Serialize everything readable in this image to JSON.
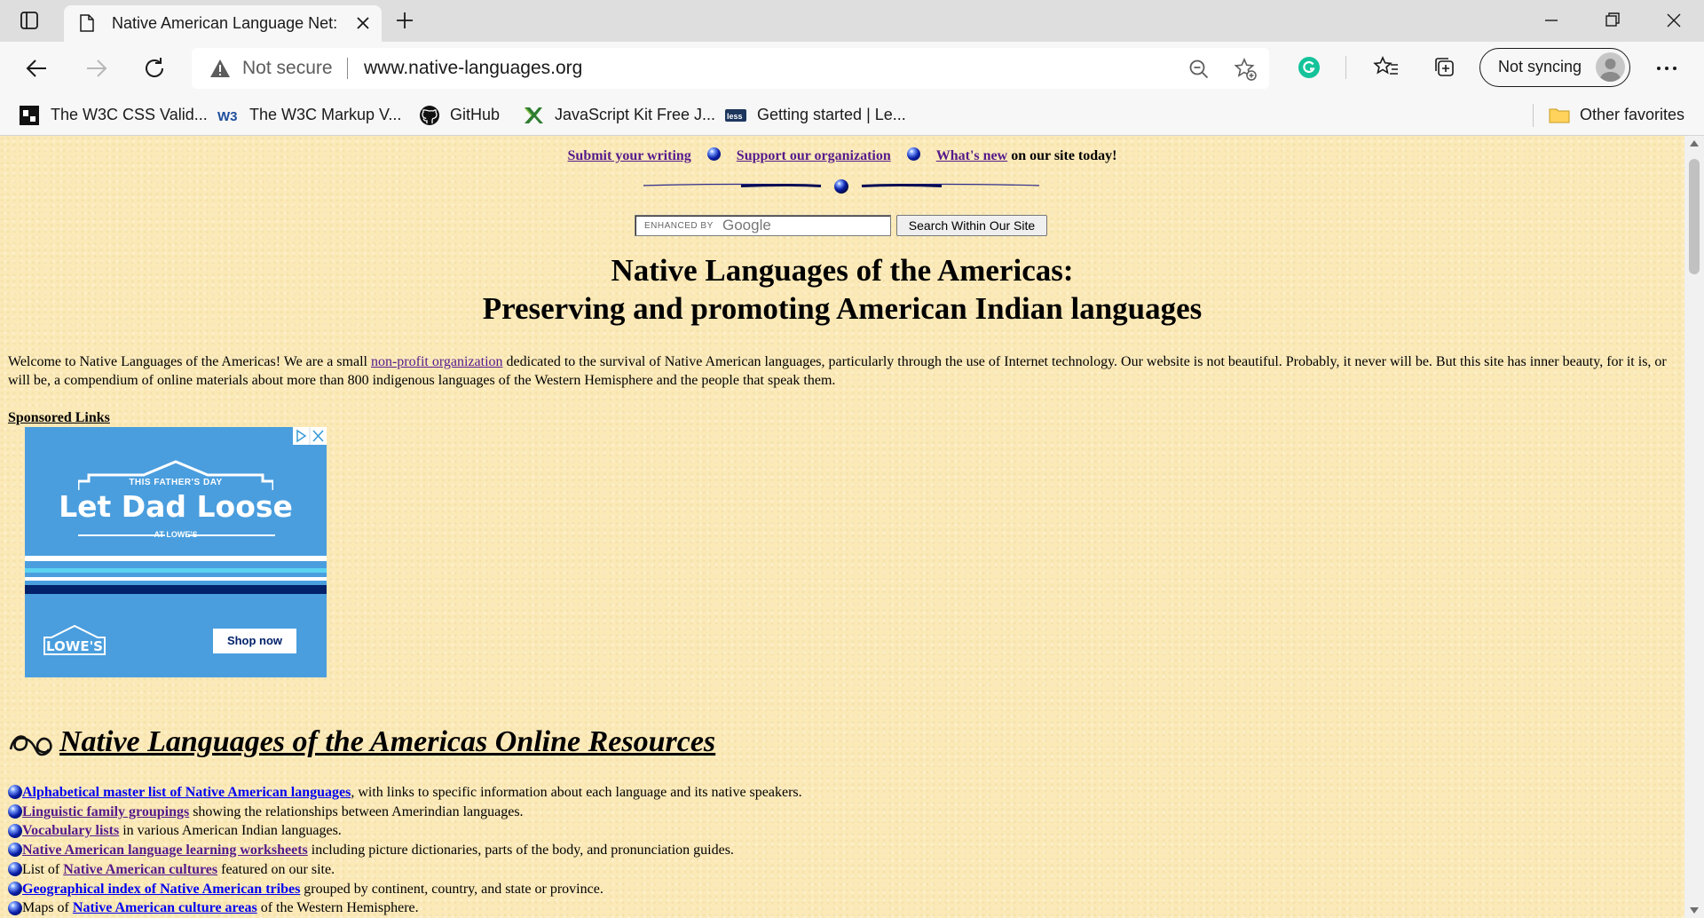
{
  "browser": {
    "tab_title": "Native American Language Net: L",
    "address": {
      "security_label": "Not secure",
      "url": "www.native-languages.org"
    },
    "profile_label": "Not syncing",
    "bookmarks": [
      {
        "label": "The W3C CSS Valid...",
        "icon": "w3c-css-icon"
      },
      {
        "label": "The W3C Markup V...",
        "icon": "w3c-icon"
      },
      {
        "label": "GitHub",
        "icon": "github-icon"
      },
      {
        "label": "JavaScript Kit Free J...",
        "icon": "javascript-kit-icon"
      },
      {
        "label": "Getting started | Le...",
        "icon": "less-icon"
      }
    ],
    "other_favorites": "Other favorites"
  },
  "page": {
    "topnav": {
      "submit": "Submit your writing",
      "support": "Support our organization",
      "whats_new": "What's new",
      "tail": "on our site today!"
    },
    "search": {
      "enhanced_by": "ENHANCED BY",
      "google": "Google",
      "button": "Search Within Our Site"
    },
    "heading_line1": "Native Languages of the Americas:",
    "heading_line2": "Preserving and promoting American Indian languages",
    "intro": {
      "before": "Welcome to Native Languages of the Americas! We are a small ",
      "link": "non-profit organization",
      "after": " dedicated to the survival of Native American languages, particularly through the use of Internet technology. Our website is not beautiful. Probably, it never will be. But this site has inner beauty, for it is, or will be, a compendium of online materials about more than 800 indigenous languages of the Western Hemisphere and the people that speak them."
    },
    "sponsored": "Sponsored Links",
    "ad": {
      "kicker": "THIS FATHER'S DAY",
      "headline": "Let Dad Loose",
      "at": "AT LOWE'S",
      "logo": "LOWE'S",
      "cta": "Shop now",
      "colors": {
        "background": "#4a9ede",
        "navy": "#012169",
        "aqua": "#5bd3f0"
      }
    },
    "resources_heading": "Native Languages of the Americas Online Resources",
    "resources": [
      {
        "prefix": "",
        "link": "Alphabetical master list of Native American languages",
        "suffix": ", with links to specific information about each language and its native speakers.",
        "visited": false
      },
      {
        "prefix": "",
        "link": "Linguistic family groupings",
        "suffix": " showing the relationships between Amerindian languages.",
        "visited": true
      },
      {
        "prefix": "",
        "link": "Vocabulary lists",
        "suffix": " in various American Indian languages.",
        "visited": true
      },
      {
        "prefix": "",
        "link": "Native American language learning worksheets",
        "suffix": " including picture dictionaries, parts of the body, and pronunciation guides.",
        "visited": true
      },
      {
        "prefix": "List of ",
        "link": "Native American cultures",
        "suffix": " featured on our site.",
        "visited": true
      },
      {
        "prefix": "",
        "link": "Geographical index of Native American tribes",
        "suffix": " grouped by continent, country, and state or province.",
        "visited": false
      },
      {
        "prefix": "Maps of ",
        "link": "Native American culture areas",
        "suffix": " of the Western Hemisphere.",
        "visited": false
      }
    ],
    "colors": {
      "background": "#fbe9b7",
      "visited_link": "#551a8b",
      "link": "#0000ee"
    }
  }
}
